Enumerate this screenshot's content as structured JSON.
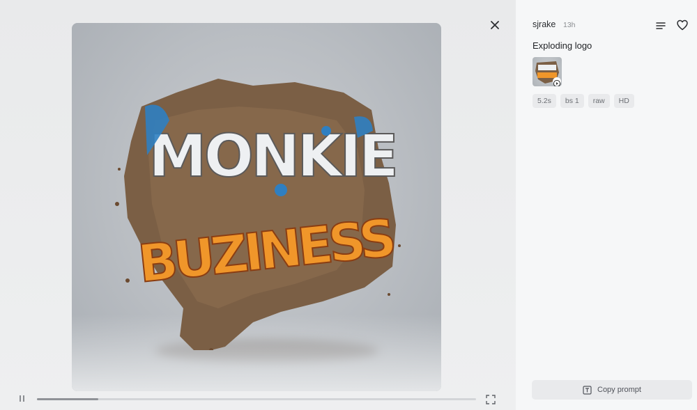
{
  "viewer": {
    "image_alt_text": "MONKIE BUZINESS",
    "progress": 0.14
  },
  "panel": {
    "username": "sjrake",
    "time_ago": "13h",
    "title": "Exploding logo",
    "tags": [
      "5.2s",
      "bs 1",
      "raw",
      "HD"
    ],
    "copy_prompt_label": "Copy prompt"
  },
  "icons": {
    "close": "close-icon",
    "pause": "pause-icon",
    "fullscreen": "fullscreen-icon",
    "menu": "menu-lines-icon",
    "favorite": "heart-icon",
    "play": "play-icon",
    "copy": "text-box-icon"
  },
  "colors": {
    "logo_white": "#eef0f2",
    "logo_orange": "#f0962a",
    "logo_blue": "#2f7fc1",
    "dirt": "#7b5f45"
  }
}
